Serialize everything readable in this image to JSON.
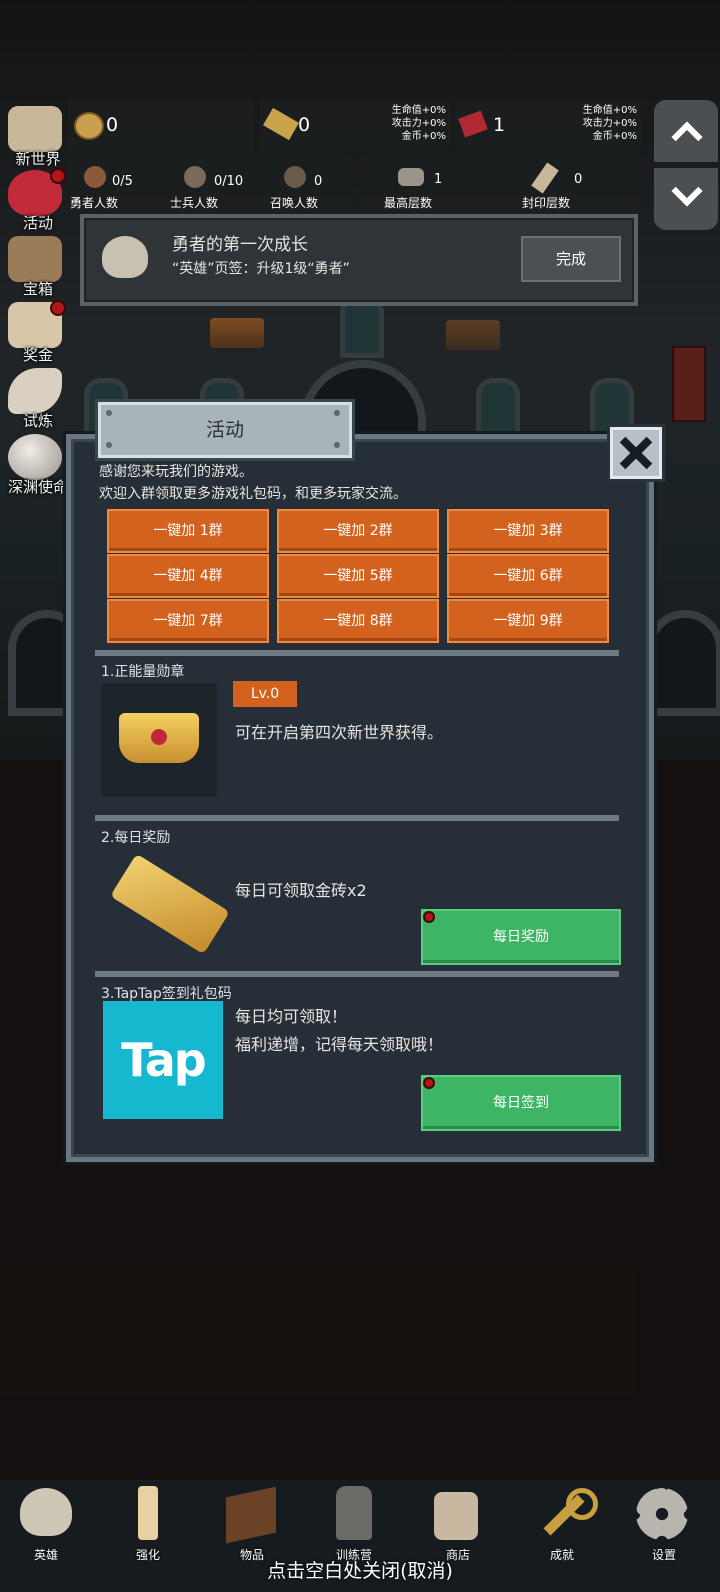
{
  "side_menu": [
    {
      "label": "新世界",
      "icon": "map-icon",
      "dot": false
    },
    {
      "label": "活动",
      "icon": "heart-icon",
      "dot": true
    },
    {
      "label": "宝箱",
      "icon": "chest-icon",
      "dot": false
    },
    {
      "label": "奖金",
      "icon": "letter-icon",
      "dot": true
    },
    {
      "label": "试炼",
      "icon": "wing-icon",
      "dot": false
    },
    {
      "label": "深渊使命",
      "icon": "orb-icon",
      "dot": false
    }
  ],
  "resources": {
    "coin": "0",
    "gold_bar": "0",
    "gem": "1",
    "bonus_lines": [
      "生命值+0%",
      "攻击力+0%",
      "金币+0%"
    ]
  },
  "counts": [
    {
      "value": "0/5",
      "label": "勇者人数",
      "icon": "hero-icon"
    },
    {
      "value": "0/10",
      "label": "士兵人数",
      "icon": "soldier-icon"
    },
    {
      "value": "0",
      "label": "召唤人数",
      "icon": "summon-icon"
    },
    {
      "value": "1",
      "label": "最高层数",
      "icon": "stone-icon"
    },
    {
      "value": "0",
      "label": "封印层数",
      "icon": "scroll-icon"
    }
  ],
  "quest": {
    "title": "勇者的第一次成长",
    "desc": "“英雄”页签：升级1级“勇者”",
    "button": "完成"
  },
  "dialog": {
    "title": "活动",
    "intro1": "感谢您来玩我们的游戏。",
    "intro2": "欢迎入群领取更多游戏礼包码，和更多玩家交流。",
    "group_buttons": [
      "一键加 1群",
      "一键加 2群",
      "一键加 3群",
      "一键加 4群",
      "一键加 5群",
      "一键加 6群",
      "一键加 7群",
      "一键加 8群",
      "一键加 9群"
    ],
    "sec1_title": "1.正能量勋章",
    "sec1_level": "Lv.0",
    "sec1_desc": "可在开启第四次新世界获得。",
    "sec2_title": "2.每日奖励",
    "sec2_desc": "每日可领取金砖x2",
    "sec2_button": "每日奖励",
    "sec3_title": "3.TapTap签到礼包码",
    "sec3_logo": "Tap",
    "sec3_line1": "每日均可领取！",
    "sec3_line2": "福利递增，记得每天领取哦！",
    "sec3_button": "每日签到"
  },
  "bottom_tabs": [
    {
      "label": "英雄",
      "icon": "skull-icon"
    },
    {
      "label": "强化",
      "icon": "candle-icon"
    },
    {
      "label": "物品",
      "icon": "book-icon"
    },
    {
      "label": "训练营",
      "icon": "lantern-icon"
    },
    {
      "label": "商店",
      "icon": "mug-icon"
    },
    {
      "label": "成就",
      "icon": "key-icon"
    },
    {
      "label": "设置",
      "icon": "gear-icon"
    }
  ],
  "close_hint": "点击空白处关闭(取消)"
}
